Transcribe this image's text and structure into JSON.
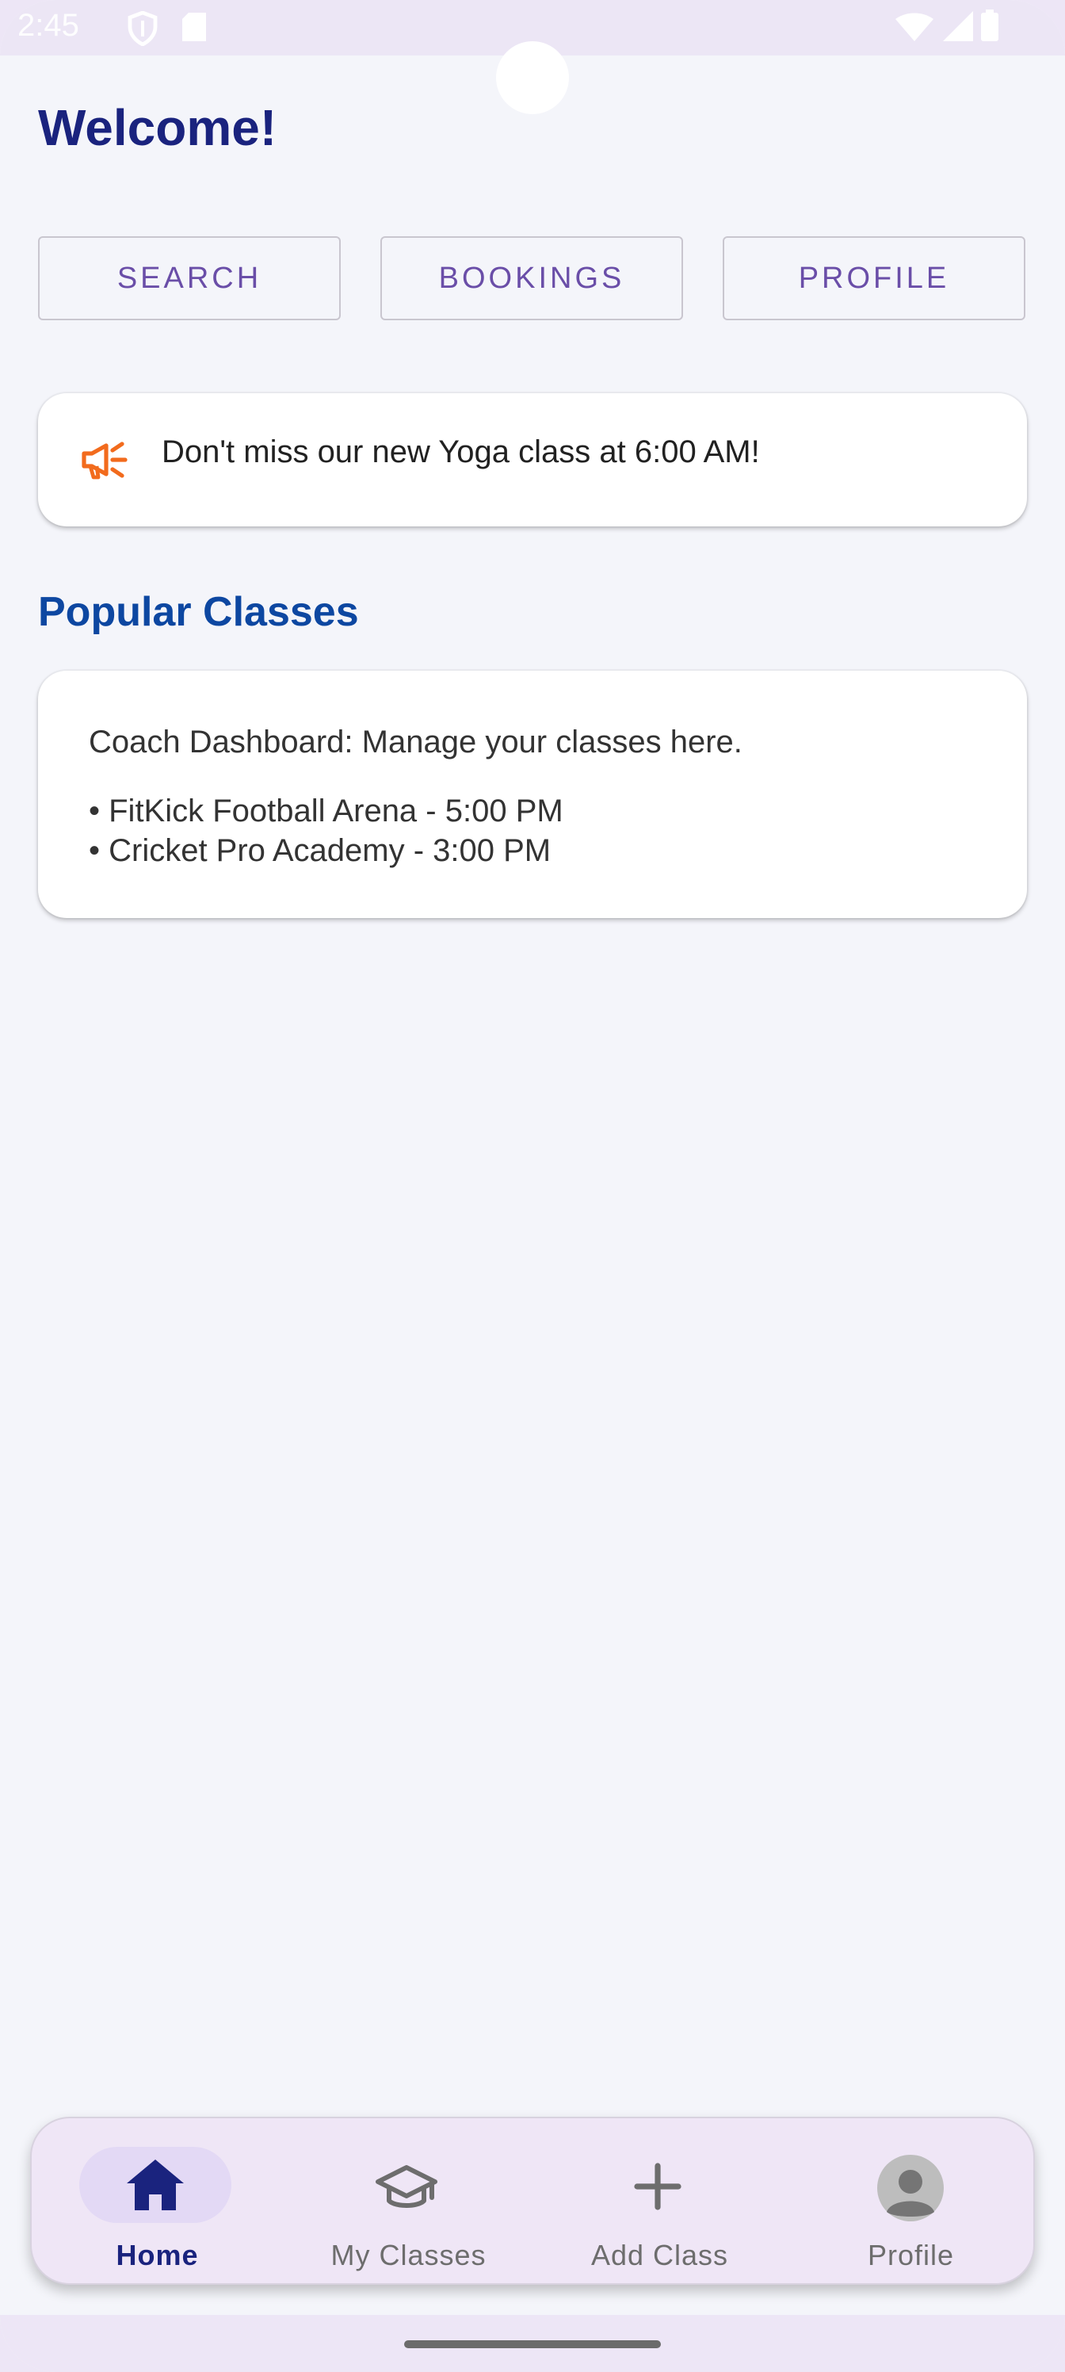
{
  "status_bar": {
    "time": "2:45"
  },
  "header": {
    "title": "Welcome!"
  },
  "top_buttons": [
    {
      "label": "SEARCH"
    },
    {
      "label": "BOOKINGS"
    },
    {
      "label": "PROFILE"
    }
  ],
  "promo": {
    "icon": "megaphone-icon",
    "text": "Don't miss our new Yoga class at 6:00 AM!"
  },
  "popular": {
    "title": "Popular Classes",
    "dashboard_text": "Coach Dashboard: Manage your classes here.",
    "classes": [
      "• FitKick Football Arena - 5:00 PM",
      "• Cricket Pro Academy - 3:00 PM"
    ]
  },
  "bottom_nav": {
    "items": [
      {
        "label": "Home",
        "icon": "home-icon",
        "active": true
      },
      {
        "label": "My Classes",
        "icon": "graduation-cap-icon",
        "active": false
      },
      {
        "label": "Add Class",
        "icon": "plus-icon",
        "active": false
      },
      {
        "label": "Profile",
        "icon": "account-circle-icon",
        "active": false
      }
    ]
  },
  "colors": {
    "title": "#1a237e",
    "section_title": "#0d47a1",
    "button_text": "#6a4ea8",
    "promo_icon": "#f26b1d",
    "nav_background": "#efe6f6",
    "nav_active_pill": "#e3d9f5"
  }
}
